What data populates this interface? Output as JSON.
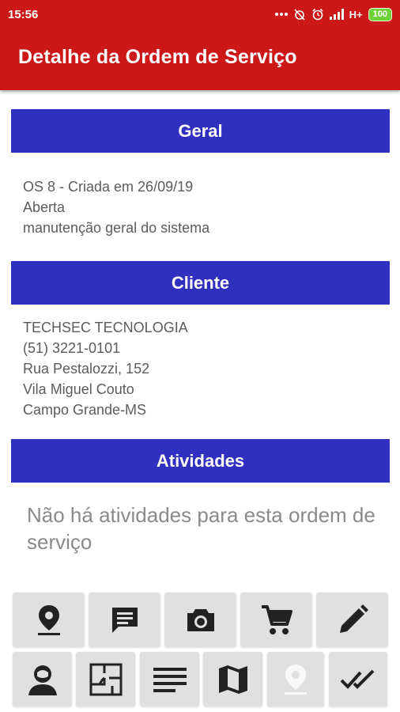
{
  "status_bar": {
    "time": "15:56",
    "network": "H+",
    "battery": "100",
    "icons": [
      "dots-icon",
      "alarm-off-icon",
      "alarm-icon",
      "signal-icon",
      "battery-icon"
    ]
  },
  "app_bar": {
    "title": "Detalhe da Ordem de Serviço"
  },
  "sections": {
    "geral": {
      "title": "Geral",
      "lines": [
        "OS 8 - Criada em 26/09/19",
        "Aberta",
        "manutenção geral do sistema"
      ]
    },
    "cliente": {
      "title": "Cliente",
      "lines": [
        "TECHSEC TECNOLOGIA",
        "(51) 3221-0101",
        "Rua Pestalozzi, 152",
        "Vila Miguel Couto",
        "Campo Grande-MS"
      ]
    },
    "atividades": {
      "title": "Atividades",
      "empty_message": "Não há atividades para esta ordem de serviço"
    }
  },
  "action_buttons": {
    "row1": [
      "location-pin-icon",
      "message-icon",
      "camera-icon",
      "cart-icon",
      "pencil-icon"
    ],
    "row2": [
      "user-icon",
      "floor-plan-icon",
      "list-icon",
      "map-icon",
      "location-pin-disabled-icon",
      "double-check-icon"
    ]
  },
  "colors": {
    "primary_red": "#cc1818",
    "header_blue": "#2f2fc0",
    "button_grey": "#e0e0e0",
    "icon_dark": "#222222",
    "icon_disabled": "#bdbdbd"
  }
}
